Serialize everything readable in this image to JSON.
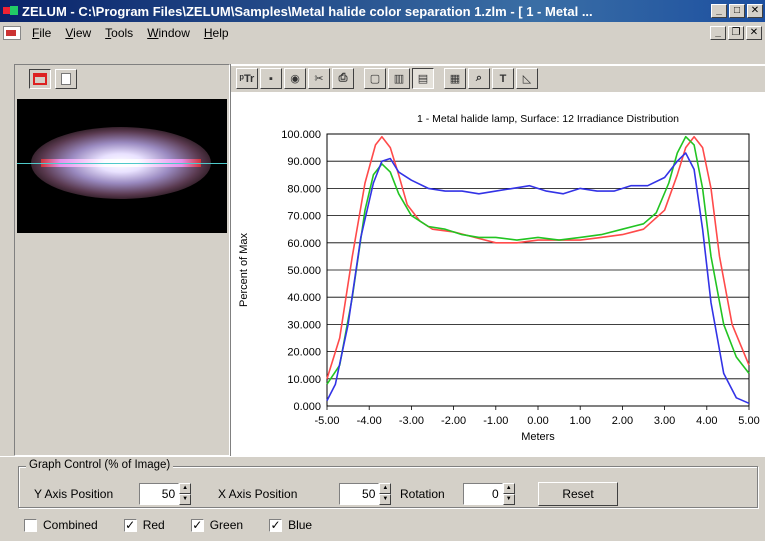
{
  "window": {
    "title": "ZELUM - C:\\Program Files\\ZELUM\\Samples\\Metal halide color separation 1.zlm - [ 1 - Metal ...",
    "minimize": "_",
    "maximize": "□",
    "close": "✕"
  },
  "menu": {
    "items": [
      "File",
      "View",
      "Tools",
      "Window",
      "Help"
    ]
  },
  "mdi": {
    "minimize": "_",
    "restore": "❐",
    "close": "✕"
  },
  "toolbar": {
    "labels": [
      "ᵖTr",
      "▪",
      "◉",
      "✂",
      "⎙",
      "▢",
      "▥",
      "▤",
      "▦",
      "⌕",
      "T",
      "◺"
    ]
  },
  "chart_data": {
    "type": "line",
    "title": "1 - Metal halide lamp, Surface: 12 Irradiance Distribution",
    "xlabel": "Meters",
    "ylabel": "Percent of Max",
    "xlim": [
      -5,
      5
    ],
    "ylim": [
      0,
      100
    ],
    "x_ticks": [
      "-5.00",
      "-4.00",
      "-3.00",
      "-2.00",
      "-1.00",
      "0.00",
      "1.00",
      "2.00",
      "3.00",
      "4.00",
      "5.00"
    ],
    "y_ticks": [
      "0.000",
      "10.000",
      "20.000",
      "30.000",
      "40.000",
      "50.000",
      "60.000",
      "70.000",
      "80.000",
      "90.000",
      "100.000"
    ],
    "grid": true,
    "series": [
      {
        "name": "Red",
        "color": "#ff4a4a",
        "points": [
          [
            -5.0,
            10
          ],
          [
            -4.7,
            25
          ],
          [
            -4.4,
            55
          ],
          [
            -4.1,
            82
          ],
          [
            -3.85,
            96
          ],
          [
            -3.7,
            99
          ],
          [
            -3.5,
            95
          ],
          [
            -3.3,
            85
          ],
          [
            -3.1,
            74
          ],
          [
            -2.8,
            68
          ],
          [
            -2.5,
            65
          ],
          [
            -2.0,
            64
          ],
          [
            -1.5,
            62
          ],
          [
            -1.0,
            60
          ],
          [
            -0.5,
            60
          ],
          [
            0.0,
            61
          ],
          [
            0.5,
            61
          ],
          [
            1.0,
            61
          ],
          [
            1.5,
            62
          ],
          [
            2.0,
            63
          ],
          [
            2.5,
            65
          ],
          [
            3.0,
            72
          ],
          [
            3.3,
            85
          ],
          [
            3.5,
            95
          ],
          [
            3.7,
            99
          ],
          [
            3.9,
            95
          ],
          [
            4.1,
            80
          ],
          [
            4.3,
            55
          ],
          [
            4.6,
            30
          ],
          [
            5.0,
            15
          ]
        ]
      },
      {
        "name": "Green",
        "color": "#22c422",
        "points": [
          [
            -5.0,
            8
          ],
          [
            -4.7,
            15
          ],
          [
            -4.4,
            40
          ],
          [
            -4.1,
            72
          ],
          [
            -3.9,
            85
          ],
          [
            -3.7,
            89
          ],
          [
            -3.5,
            86
          ],
          [
            -3.3,
            78
          ],
          [
            -3.0,
            70
          ],
          [
            -2.6,
            66
          ],
          [
            -2.2,
            65
          ],
          [
            -1.8,
            63
          ],
          [
            -1.4,
            62
          ],
          [
            -1.0,
            62
          ],
          [
            -0.5,
            61
          ],
          [
            0.0,
            62
          ],
          [
            0.5,
            61
          ],
          [
            1.0,
            62
          ],
          [
            1.5,
            63
          ],
          [
            2.0,
            65
          ],
          [
            2.5,
            67
          ],
          [
            2.8,
            71
          ],
          [
            3.1,
            82
          ],
          [
            3.3,
            93
          ],
          [
            3.5,
            99
          ],
          [
            3.7,
            96
          ],
          [
            3.9,
            80
          ],
          [
            4.1,
            55
          ],
          [
            4.4,
            30
          ],
          [
            4.7,
            18
          ],
          [
            5.0,
            12
          ]
        ]
      },
      {
        "name": "Blue",
        "color": "#3333e6",
        "points": [
          [
            -5.0,
            2
          ],
          [
            -4.8,
            8
          ],
          [
            -4.5,
            30
          ],
          [
            -4.2,
            62
          ],
          [
            -3.9,
            82
          ],
          [
            -3.7,
            90
          ],
          [
            -3.5,
            91
          ],
          [
            -3.3,
            86
          ],
          [
            -3.0,
            83
          ],
          [
            -2.6,
            80
          ],
          [
            -2.2,
            79
          ],
          [
            -1.8,
            79
          ],
          [
            -1.4,
            78
          ],
          [
            -1.0,
            79
          ],
          [
            -0.6,
            80
          ],
          [
            -0.2,
            81
          ],
          [
            0.2,
            79
          ],
          [
            0.6,
            78
          ],
          [
            1.0,
            80
          ],
          [
            1.4,
            79
          ],
          [
            1.8,
            79
          ],
          [
            2.2,
            81
          ],
          [
            2.6,
            81
          ],
          [
            3.0,
            84
          ],
          [
            3.3,
            90
          ],
          [
            3.5,
            93
          ],
          [
            3.7,
            87
          ],
          [
            3.9,
            65
          ],
          [
            4.1,
            38
          ],
          [
            4.4,
            12
          ],
          [
            4.7,
            3
          ],
          [
            5.0,
            1
          ]
        ]
      }
    ]
  },
  "graph_control": {
    "legend": "Graph Control (% of Image)",
    "y_axis_label": "Y Axis Position",
    "y_axis_value": "50",
    "x_axis_label": "X Axis Position",
    "x_axis_value": "50",
    "rotation_label": "Rotation",
    "rotation_value": "0",
    "reset_label": "Reset"
  },
  "checkboxes": [
    {
      "label": "Combined",
      "checked": false
    },
    {
      "label": "Red",
      "checked": true
    },
    {
      "label": "Green",
      "checked": true
    },
    {
      "label": "Blue",
      "checked": true
    }
  ]
}
